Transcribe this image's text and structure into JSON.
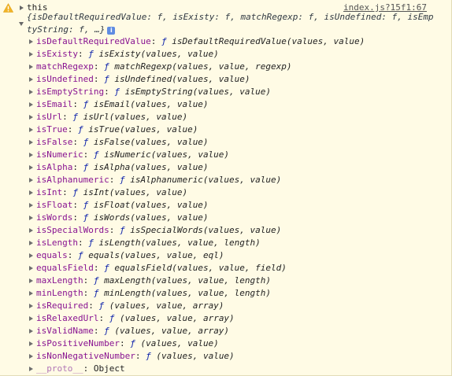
{
  "header": {
    "icon": "warning-icon",
    "label": "this",
    "source": "index.js?15f1:67"
  },
  "summary": {
    "text": "{isDefaultRequiredValue: f, isExisty: f, matchRegexp: f, isUndefined: f, isEmptyString: f, …}",
    "info_icon": "i"
  },
  "properties": [
    {
      "key": "isDefaultRequiredValue",
      "f": "ƒ",
      "sig": "isDefaultRequiredValue(values, value)"
    },
    {
      "key": "isExisty",
      "f": "ƒ",
      "sig": "isExisty(values, value)"
    },
    {
      "key": "matchRegexp",
      "f": "ƒ",
      "sig": "matchRegexp(values, value, regexp)"
    },
    {
      "key": "isUndefined",
      "f": "ƒ",
      "sig": "isUndefined(values, value)"
    },
    {
      "key": "isEmptyString",
      "f": "ƒ",
      "sig": "isEmptyString(values, value)"
    },
    {
      "key": "isEmail",
      "f": "ƒ",
      "sig": "isEmail(values, value)"
    },
    {
      "key": "isUrl",
      "f": "ƒ",
      "sig": "isUrl(values, value)"
    },
    {
      "key": "isTrue",
      "f": "ƒ",
      "sig": "isTrue(values, value)"
    },
    {
      "key": "isFalse",
      "f": "ƒ",
      "sig": "isFalse(values, value)"
    },
    {
      "key": "isNumeric",
      "f": "ƒ",
      "sig": "isNumeric(values, value)"
    },
    {
      "key": "isAlpha",
      "f": "ƒ",
      "sig": "isAlpha(values, value)"
    },
    {
      "key": "isAlphanumeric",
      "f": "ƒ",
      "sig": "isAlphanumeric(values, value)"
    },
    {
      "key": "isInt",
      "f": "ƒ",
      "sig": "isInt(values, value)"
    },
    {
      "key": "isFloat",
      "f": "ƒ",
      "sig": "isFloat(values, value)"
    },
    {
      "key": "isWords",
      "f": "ƒ",
      "sig": "isWords(values, value)"
    },
    {
      "key": "isSpecialWords",
      "f": "ƒ",
      "sig": "isSpecialWords(values, value)"
    },
    {
      "key": "isLength",
      "f": "ƒ",
      "sig": "isLength(values, value, length)"
    },
    {
      "key": "equals",
      "f": "ƒ",
      "sig": "equals(values, value, eql)"
    },
    {
      "key": "equalsField",
      "f": "ƒ",
      "sig": "equalsField(values, value, field)"
    },
    {
      "key": "maxLength",
      "f": "ƒ",
      "sig": "maxLength(values, value, length)"
    },
    {
      "key": "minLength",
      "f": "ƒ",
      "sig": "minLength(values, value, length)"
    },
    {
      "key": "isRequired",
      "f": "ƒ",
      "sig": "(values, value, array)"
    },
    {
      "key": "isRelaxedUrl",
      "f": "ƒ",
      "sig": "(values, value, array)"
    },
    {
      "key": "isValidName",
      "f": "ƒ",
      "sig": "(values, value, array)"
    },
    {
      "key": "isPositiveNumber",
      "f": "ƒ",
      "sig": "(values, value)"
    },
    {
      "key": "isNonNegativeNumber",
      "f": "ƒ",
      "sig": "(values, value)"
    }
  ],
  "proto": {
    "key": "__proto__",
    "value": "Object"
  },
  "colors": {
    "background": "#fffbe5",
    "warning": "#f2b428",
    "property_key": "#881391",
    "function_keyword": "#0d22aa",
    "info_badge": "#5f8ce2"
  }
}
